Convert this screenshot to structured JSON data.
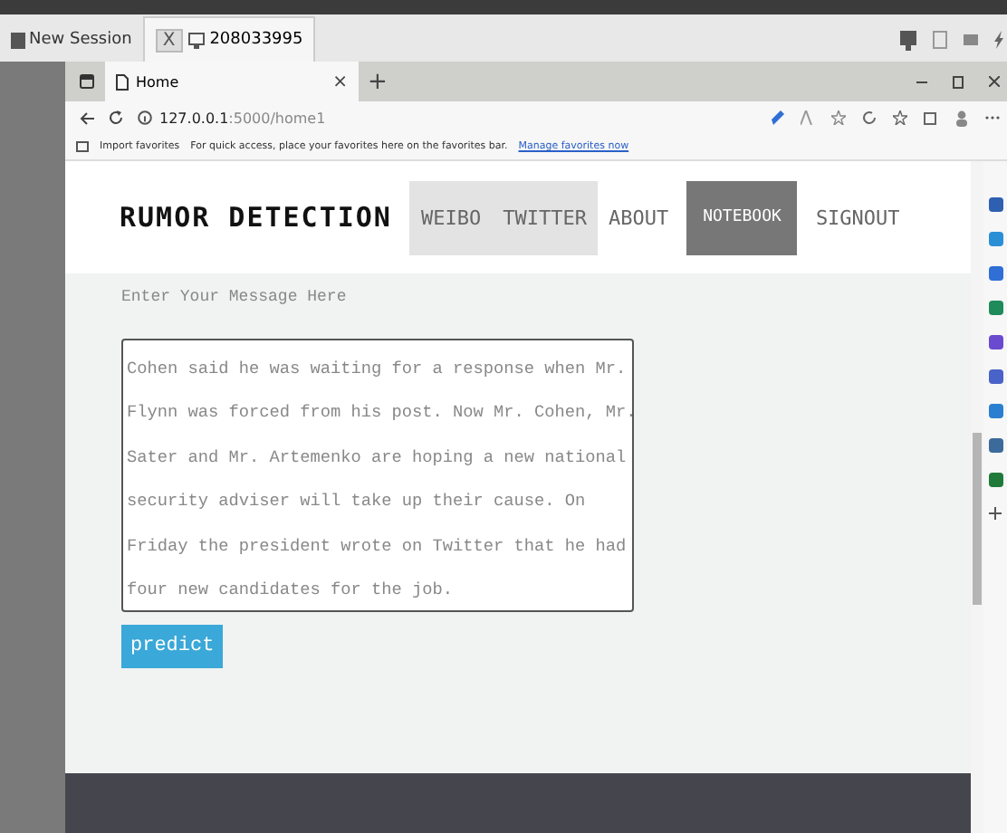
{
  "session_bar": {
    "new_session": "New Session",
    "tabs": [
      {
        "close": "X",
        "label": "208033995",
        "selected": true
      }
    ]
  },
  "browser": {
    "tab": {
      "title": "Home",
      "close": "×"
    },
    "new_tab": "+",
    "url_host": "127.0.0.1",
    "url_rest": ":5000/home1",
    "favorites_bar": {
      "import": "Import favorites",
      "hint": "For quick access, place your favorites here on the favorites bar.",
      "link": "Manage favorites now"
    }
  },
  "page": {
    "brand": "RUMOR DETECTION",
    "nav": [
      {
        "label": "WEIBO",
        "highlighted": true,
        "selected": false
      },
      {
        "label": "TWITTER",
        "highlighted": true,
        "selected": false
      },
      {
        "label": "ABOUT",
        "highlighted": false,
        "selected": false
      },
      {
        "label": "NOTEBOOK",
        "highlighted": false,
        "selected": true
      },
      {
        "label": "SIGNOUT",
        "highlighted": false,
        "selected": false
      }
    ],
    "message_label": "Enter Your Message Here",
    "message_lines": [
      "Cohen said he was waiting for a response when Mr.",
      "Flynn was forced from his post. Now Mr. Cohen, Mr.",
      "Sater and Mr. Artemenko are hoping a new national",
      "security adviser will take up their cause. On",
      "Friday the president wrote on Twitter that he had",
      "four new candidates for the job."
    ],
    "predict_button": "predict"
  }
}
